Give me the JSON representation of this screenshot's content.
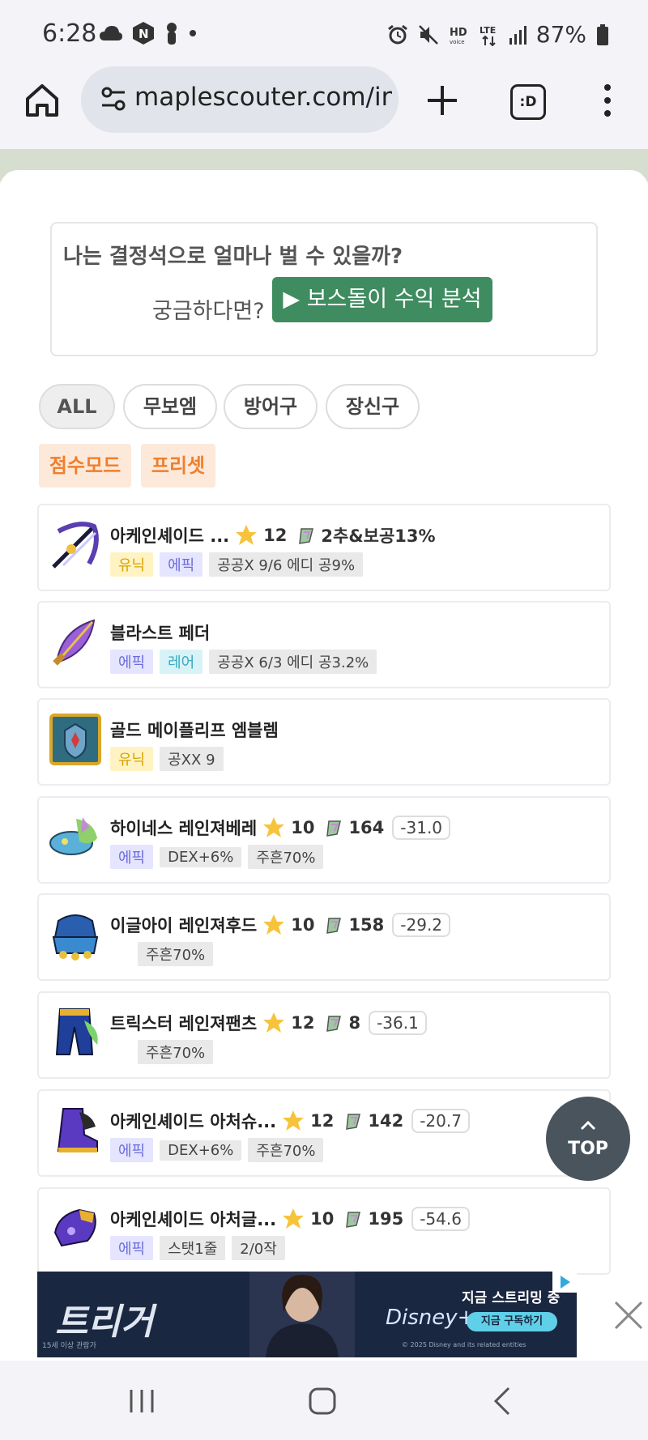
{
  "status_bar": {
    "time": "6:28",
    "battery": "87%",
    "icons": [
      "cloud-icon",
      "n-app-icon",
      "person-icon",
      "dot-icon",
      "alarm-icon",
      "mute-icon",
      "hd-voice-icon",
      "lte-icon",
      "signal-icon",
      "battery-icon"
    ]
  },
  "browser": {
    "url": "maplescouter.com/in",
    "tabs_label": ":D"
  },
  "promo": {
    "question": "나는 결정석으로 얼마나 벌 수 있을까?",
    "subtitle": "궁금하다면?",
    "button_label": "▶ 보스돌이 수익 분석",
    "button_color": "#3f8c60"
  },
  "filters": [
    {
      "label": "ALL",
      "active": true
    },
    {
      "label": "무보엠",
      "active": false
    },
    {
      "label": "방어구",
      "active": false
    },
    {
      "label": "장신구",
      "active": false
    }
  ],
  "modes": [
    {
      "label": "점수모드"
    },
    {
      "label": "프리셋"
    }
  ],
  "items": [
    {
      "name": "아케인셰이드 ...",
      "star": "12",
      "potential": "2추&보공13%",
      "score": "",
      "tags": [
        {
          "text": "유닉",
          "type": "unique"
        },
        {
          "text": "에픽",
          "type": "epic"
        },
        {
          "text": "공공X 9/6 에디 공9%",
          "type": "opt"
        }
      ],
      "icon": "bow-weapon-icon"
    },
    {
      "name": "블라스트 페더",
      "star": "",
      "potential": "",
      "score": "",
      "tags": [
        {
          "text": "에픽",
          "type": "epic"
        },
        {
          "text": "레어",
          "type": "rare"
        },
        {
          "text": "공공X 6/3 에디 공3.2%",
          "type": "opt"
        }
      ],
      "icon": "feather-arrowhead-icon"
    },
    {
      "name": "골드 메이플리프 엠블렘",
      "star": "",
      "potential": "",
      "score": "",
      "tags": [
        {
          "text": "유닉",
          "type": "unique"
        },
        {
          "text": "공XX 9",
          "type": "opt"
        }
      ],
      "icon": "emblem-icon"
    },
    {
      "name": "하이네스 레인져베레",
      "star": "10",
      "potential": "164",
      "score": "-31.0",
      "tags": [
        {
          "text": "에픽",
          "type": "epic"
        },
        {
          "text": "DEX+6%",
          "type": "opt"
        },
        {
          "text": "주흔70%",
          "type": "opt"
        }
      ],
      "icon": "beret-hat-icon"
    },
    {
      "name": "이글아이 레인져후드",
      "star": "10",
      "potential": "158",
      "score": "-29.2",
      "tags": [
        {
          "text": "주흔70%",
          "type": "opt"
        }
      ],
      "icon": "hood-top-icon"
    },
    {
      "name": "트릭스터 레인져팬츠",
      "star": "12",
      "potential": "8",
      "score": "-36.1",
      "tags": [
        {
          "text": "주흔70%",
          "type": "opt"
        }
      ],
      "icon": "pants-icon"
    },
    {
      "name": "아케인셰이드 아처슈...",
      "star": "12",
      "potential": "142",
      "score": "-20.7",
      "tags": [
        {
          "text": "에픽",
          "type": "epic"
        },
        {
          "text": "DEX+6%",
          "type": "opt"
        },
        {
          "text": "주흔70%",
          "type": "opt"
        }
      ],
      "icon": "boots-icon"
    },
    {
      "name": "아케인셰이드 아처글...",
      "star": "10",
      "potential": "195",
      "score": "-54.6",
      "tags": [
        {
          "text": "에픽",
          "type": "epic"
        },
        {
          "text": "스탯1줄",
          "type": "opt"
        },
        {
          "text": "2/0작",
          "type": "opt"
        }
      ],
      "icon": "glove-icon"
    }
  ],
  "top_button": {
    "label": "TOP"
  },
  "ad": {
    "title": "트리거",
    "brand": "Disney+",
    "streaming": "지금 스트리밍 중",
    "subscribe": "지금 구독하기",
    "rating": "15세 이상 관람가",
    "copyright": "© 2025 Disney and its related entities"
  },
  "nav": {
    "icons": [
      "recent-apps-icon",
      "home-icon",
      "back-icon"
    ]
  },
  "colors": {
    "accent_green": "#3f8c60",
    "mode_orange": "#ef7f2c",
    "top_button": "#4a545c"
  }
}
